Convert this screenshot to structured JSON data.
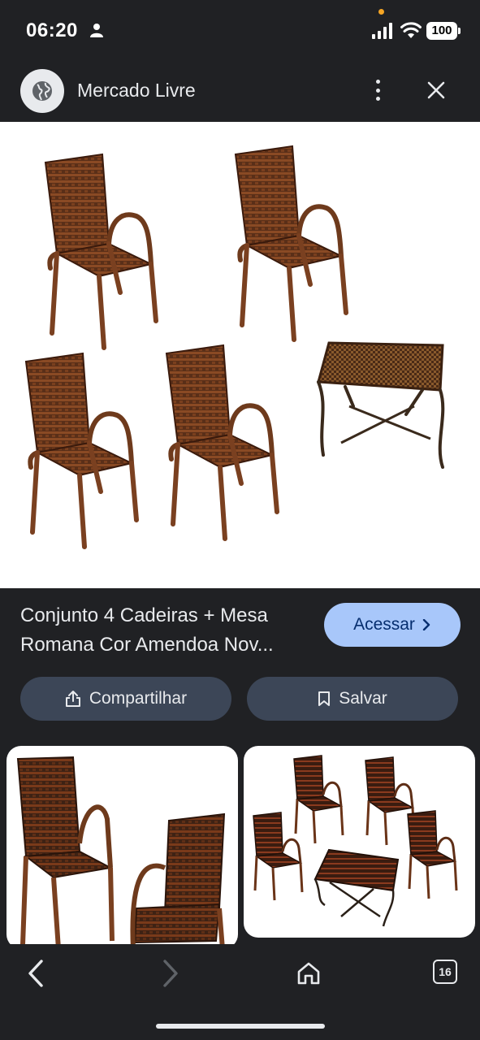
{
  "status_bar": {
    "time": "06:20",
    "battery": "100"
  },
  "app_bar": {
    "title": "Mercado Livre"
  },
  "product": {
    "title": "Conjunto 4 Cadeiras + Mesa Romana Cor Amendoa Nov...",
    "visit_label": "Acessar",
    "share_label": "Compartilhar",
    "save_label": "Salvar"
  },
  "nav": {
    "tab_count": "16"
  },
  "colors": {
    "background": "#202124",
    "accent": "#a8c7fa",
    "chip": "#3c4657",
    "wicker": "#6b3a1f"
  },
  "icons": [
    "person-icon",
    "signal-icon",
    "wifi-icon",
    "globe-icon",
    "more-vert-icon",
    "close-icon",
    "share-icon",
    "bookmark-icon",
    "back-icon",
    "forward-icon",
    "home-icon"
  ]
}
